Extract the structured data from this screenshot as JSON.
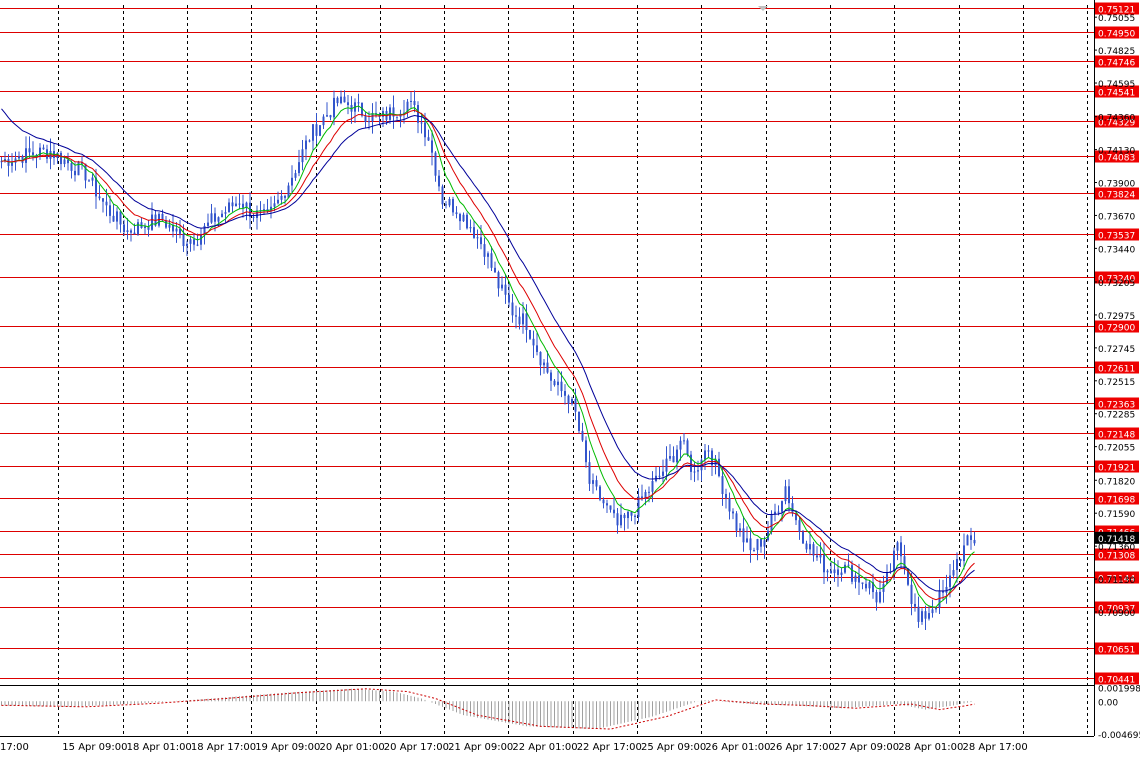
{
  "chart_data": {
    "type": "candlestick",
    "colors": {
      "background": "#ffffff",
      "candle": "#3355cc",
      "grid": "#000000",
      "level_line": "#dd0000",
      "level_label_bg": "#ee0000",
      "level_label_text": "#ffffff",
      "ma_fast": "#00bb00",
      "ma_mid": "#dd0000",
      "ma_slow": "#000099",
      "oscillator_bar": "#a0a0a0",
      "oscillator_signal": "#cc0000",
      "current_price_bg": "#000000"
    },
    "ylim": [
      0.7039,
      0.7514
    ],
    "x_labels": [
      "17:00",
      "15 Apr 09:00",
      "18 Apr 01:00",
      "18 Apr 17:00",
      "19 Apr 09:00",
      "20 Apr 01:00",
      "20 Apr 17:00",
      "21 Apr 09:00",
      "22 Apr 01:00",
      "22 Apr 17:00",
      "25 Apr 09:00",
      "26 Apr 01:00",
      "26 Apr 17:00",
      "27 Apr 09:00",
      "28 Apr 01:00",
      "28 Apr 17:00"
    ],
    "price_ticks": [
      "0.75055",
      "0.74825",
      "0.74595",
      "0.74360",
      "0.74130",
      "0.73900",
      "0.73670",
      "0.73440",
      "0.73205",
      "0.72975",
      "0.72745",
      "0.72515",
      "0.72285",
      "0.72055",
      "0.71820",
      "0.71590",
      "0.71360",
      "0.71130",
      "0.70900"
    ],
    "levels": [
      "0.75121",
      "0.74950",
      "0.74746",
      "0.74541",
      "0.74329",
      "0.74083",
      "0.73824",
      "0.73537",
      "0.73240",
      "0.72900",
      "0.72611",
      "0.72363",
      "0.72148",
      "0.71921",
      "0.71698",
      "0.71466",
      "0.71308",
      "0.71144",
      "0.70937",
      "0.70651",
      "0.70441"
    ],
    "current_price": "0.71418",
    "oscillator": {
      "ticks": [
        "0.001998",
        "0.00",
        "-0.004695"
      ],
      "ylim": [
        -0.005,
        0.0022
      ]
    },
    "price_path": [
      [
        0,
        0.7405
      ],
      [
        8,
        0.741
      ],
      [
        14,
        0.7412
      ],
      [
        20,
        0.7402
      ],
      [
        24,
        0.7396
      ],
      [
        30,
        0.7372
      ],
      [
        36,
        0.7356
      ],
      [
        42,
        0.7362
      ],
      [
        46,
        0.7364
      ],
      [
        52,
        0.735
      ],
      [
        56,
        0.7352
      ],
      [
        60,
        0.7363
      ],
      [
        64,
        0.737
      ],
      [
        68,
        0.7378
      ],
      [
        72,
        0.7368
      ],
      [
        76,
        0.7365
      ],
      [
        80,
        0.738
      ],
      [
        84,
        0.74
      ],
      [
        88,
        0.7422
      ],
      [
        92,
        0.7435
      ],
      [
        96,
        0.7446
      ],
      [
        100,
        0.7444
      ],
      [
        104,
        0.7438
      ],
      [
        108,
        0.7434
      ],
      [
        112,
        0.744
      ],
      [
        116,
        0.7446
      ],
      [
        118,
        0.744
      ],
      [
        120,
        0.7432
      ],
      [
        122,
        0.7422
      ],
      [
        124,
        0.74
      ],
      [
        126,
        0.7378
      ],
      [
        130,
        0.7372
      ],
      [
        134,
        0.736
      ],
      [
        138,
        0.7344
      ],
      [
        142,
        0.7318
      ],
      [
        146,
        0.73
      ],
      [
        150,
        0.7292
      ],
      [
        154,
        0.7268
      ],
      [
        158,
        0.7248
      ],
      [
        162,
        0.724
      ],
      [
        164,
        0.7228
      ],
      [
        166,
        0.7205
      ],
      [
        168,
        0.718
      ],
      [
        172,
        0.7166
      ],
      [
        176,
        0.715
      ],
      [
        180,
        0.7158
      ],
      [
        184,
        0.7172
      ],
      [
        188,
        0.7185
      ],
      [
        192,
        0.72
      ],
      [
        194,
        0.721
      ],
      [
        196,
        0.7198
      ],
      [
        198,
        0.7186
      ],
      [
        200,
        0.72
      ],
      [
        202,
        0.7205
      ],
      [
        206,
        0.7178
      ],
      [
        210,
        0.715
      ],
      [
        214,
        0.7132
      ],
      [
        218,
        0.7142
      ],
      [
        222,
        0.7165
      ],
      [
        224,
        0.7178
      ],
      [
        226,
        0.716
      ],
      [
        228,
        0.7148
      ],
      [
        232,
        0.713
      ],
      [
        236,
        0.712
      ],
      [
        240,
        0.7122
      ],
      [
        244,
        0.7115
      ],
      [
        248,
        0.7108
      ],
      [
        250,
        0.71
      ],
      [
        252,
        0.7105
      ],
      [
        256,
        0.7135
      ],
      [
        258,
        0.7125
      ],
      [
        260,
        0.71
      ],
      [
        262,
        0.7082
      ],
      [
        266,
        0.7094
      ],
      [
        268,
        0.71
      ],
      [
        270,
        0.7104
      ],
      [
        272,
        0.7122
      ],
      [
        274,
        0.713
      ],
      [
        276,
        0.7138
      ],
      [
        278,
        0.714
      ]
    ],
    "oscillator_path": [
      [
        0,
        -0.0006
      ],
      [
        20,
        -0.0008
      ],
      [
        40,
        -0.0003
      ],
      [
        60,
        0.0004
      ],
      [
        80,
        0.0012
      ],
      [
        100,
        0.0018
      ],
      [
        112,
        0.0014
      ],
      [
        120,
        0.0004
      ],
      [
        132,
        -0.002
      ],
      [
        150,
        -0.0036
      ],
      [
        170,
        -0.004
      ],
      [
        186,
        -0.0022
      ],
      [
        200,
        0.0002
      ],
      [
        214,
        -0.0004
      ],
      [
        226,
        -0.0006
      ],
      [
        240,
        -0.001
      ],
      [
        256,
        -0.0004
      ],
      [
        264,
        -0.0012
      ],
      [
        272,
        -0.0006
      ],
      [
        278,
        0.0
      ]
    ]
  }
}
